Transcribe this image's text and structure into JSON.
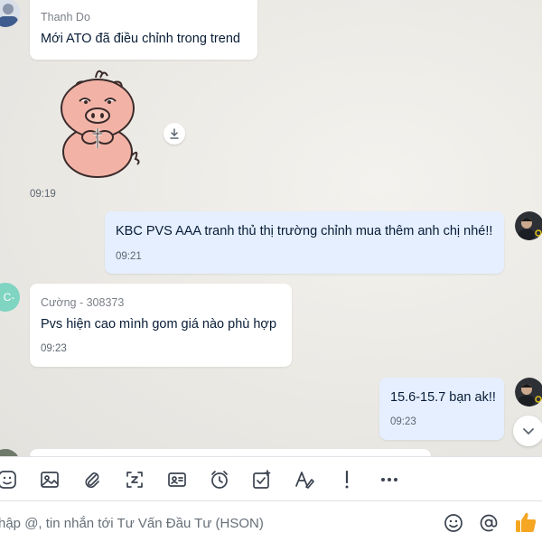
{
  "messages": [
    {
      "sender": "Thanh Do",
      "text": "Mới ATO đã điều chỉnh trong trend"
    },
    {
      "type": "sticker",
      "sticker": "pig-praying-sticker",
      "time": "09:19"
    },
    {
      "text": "KBC PVS AAA tranh thủ thị trường chỉnh mua thêm anh chị nhé!!",
      "time": "09:21"
    },
    {
      "sender": "Cường - 308373",
      "avatar_initials": "C-",
      "text": "Pvs hiện cao mình gom giá nào phù hợp",
      "time": "09:23"
    },
    {
      "text": "15.6-15.7 bạn ak!!",
      "time": "09:23"
    }
  ],
  "composer": {
    "placeholder": "hập @, tin nhắn tới Tư Vấn Đầu Tư (HSON)",
    "toolbar_icons": [
      "sticker-icon",
      "image-icon",
      "attachment-icon",
      "screenshot-icon",
      "contact-card-icon",
      "reminder-clock-icon",
      "task-icon",
      "text-format-icon",
      "urgent-icon",
      "more-icon"
    ],
    "right_icons": [
      "emoji-icon",
      "mention-icon",
      "thumbs-up-icon"
    ]
  },
  "colors": {
    "incoming_bubble": "#ffffff",
    "outgoing_bubble": "#e5efff",
    "thumbs_up": "#f5a623",
    "avatar_c": "#7fd4c2"
  }
}
